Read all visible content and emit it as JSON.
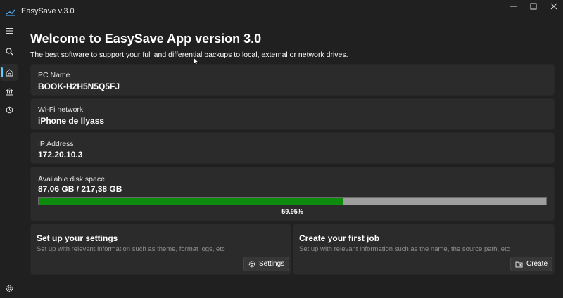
{
  "window": {
    "title": "EasySave v.3.0",
    "controls": [
      "minimize-icon",
      "maximize-icon",
      "close-icon"
    ]
  },
  "rail": {
    "items": [
      {
        "name": "menu",
        "icon": "hamburger-icon"
      },
      {
        "name": "search",
        "icon": "search-icon"
      },
      {
        "name": "home",
        "icon": "home-icon",
        "active": true
      },
      {
        "name": "jobs",
        "icon": "bank-icon"
      },
      {
        "name": "history",
        "icon": "history-icon"
      },
      {
        "name": "settings",
        "icon": "gear-icon"
      }
    ]
  },
  "header": {
    "title": "Welcome to EasySave App version 3.0",
    "subtitle": "The best software to support your full and differential backups to local, external or network drives."
  },
  "info": {
    "pc_name_label": "PC Name",
    "pc_name_value": "BOOK-H2H5N5Q5FJ",
    "wifi_label": "Wi-Fi network",
    "wifi_value": "iPhone de Ilyass",
    "ip_label": "IP Address",
    "ip_value": "172.20.10.3",
    "disk_label": "Available disk space",
    "disk_value": "87,06 GB / 217,38 GB",
    "disk_percent_text": "59.95%",
    "disk_fraction": 0.5995
  },
  "settings_card": {
    "title": "Set up your settings",
    "description": "Set up with relevant information such as theme, format logs, etc",
    "button_label": "Settings"
  },
  "job_card": {
    "title": "Create your first job",
    "description": "Set up with relevant information such as the name, the source path, etc",
    "button_label": "Create"
  },
  "colors": {
    "background": "#202020",
    "card": "#2b2b2b",
    "accent": "#60cdff",
    "progress_fill": "#0e8a0e",
    "progress_track": "#9e9e9e"
  }
}
